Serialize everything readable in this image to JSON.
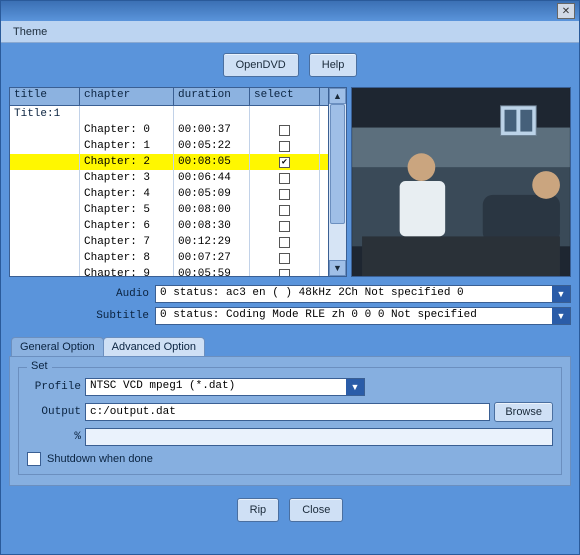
{
  "window": {
    "title": ""
  },
  "menu": {
    "theme": "Theme"
  },
  "buttons": {
    "openDvd": "OpenDVD",
    "help": "Help",
    "rip": "Rip",
    "close": "Close",
    "browse": "Browse"
  },
  "columns": {
    "title": "title",
    "chapter": "chapter",
    "duration": "duration",
    "select": "select"
  },
  "rows": [
    {
      "title": "Title:1",
      "chapter": "",
      "duration": "",
      "checkbox": false,
      "titleRow": true
    },
    {
      "title": "",
      "chapter": "Chapter:  0",
      "duration": "00:00:37",
      "checkbox": false
    },
    {
      "title": "",
      "chapter": "Chapter:  1",
      "duration": "00:05:22",
      "checkbox": false
    },
    {
      "title": "",
      "chapter": "Chapter:  2",
      "duration": "00:08:05",
      "checkbox": true,
      "selected": true
    },
    {
      "title": "",
      "chapter": "Chapter:  3",
      "duration": "00:06:44",
      "checkbox": false
    },
    {
      "title": "",
      "chapter": "Chapter:  4",
      "duration": "00:05:09",
      "checkbox": false
    },
    {
      "title": "",
      "chapter": "Chapter:  5",
      "duration": "00:08:00",
      "checkbox": false
    },
    {
      "title": "",
      "chapter": "Chapter:  6",
      "duration": "00:08:30",
      "checkbox": false
    },
    {
      "title": "",
      "chapter": "Chapter:  7",
      "duration": "00:12:29",
      "checkbox": false
    },
    {
      "title": "",
      "chapter": "Chapter:  8",
      "duration": "00:07:27",
      "checkbox": false
    },
    {
      "title": "",
      "chapter": "Chapter:  9",
      "duration": "00:05:59",
      "checkbox": false
    }
  ],
  "audio": {
    "label": "Audio",
    "value": "0 status: ac3 en ( ) 48kHz 2Ch Not specified 0"
  },
  "subtitle": {
    "label": "Subtitle",
    "value": "0 status: Coding Mode RLE zh 0 0 0 Not specified"
  },
  "tabs": {
    "general": "General Option",
    "advanced": "Advanced Option",
    "active": "general"
  },
  "set": {
    "legend": "Set",
    "profileLabel": "Profile",
    "profileValue": "NTSC VCD mpeg1 (*.dat)",
    "outputLabel": "Output",
    "outputValue": "c:/output.dat",
    "percentLabel": "%",
    "shutdownLabel": "Shutdown when done",
    "shutdownChecked": false
  }
}
